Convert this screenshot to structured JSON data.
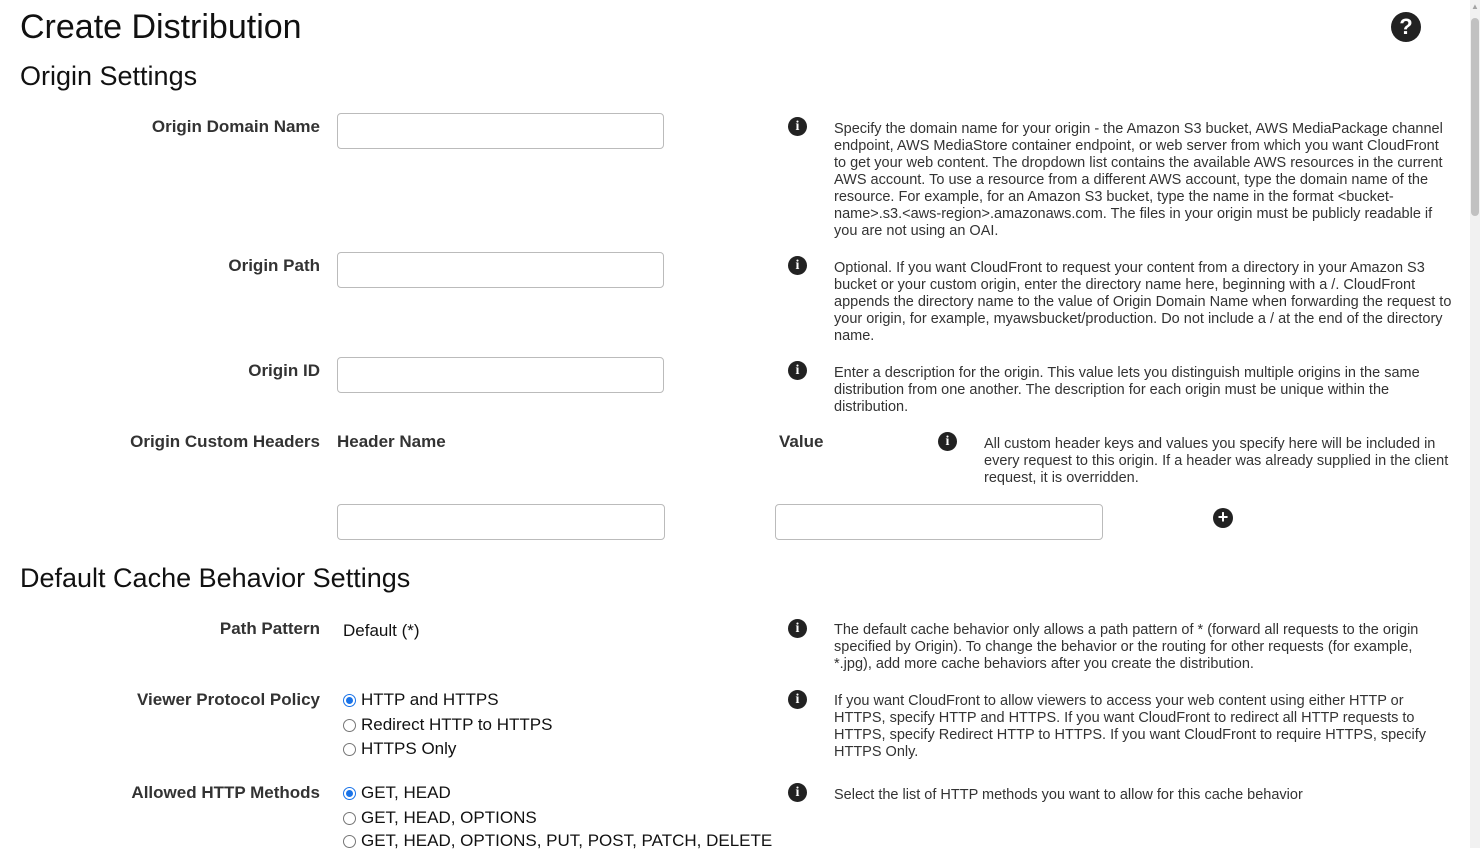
{
  "page": {
    "title": "Create Distribution",
    "help_icon": "question-circle-icon"
  },
  "origin_settings": {
    "heading": "Origin Settings",
    "origin_domain_name": {
      "label": "Origin Domain Name",
      "value": "",
      "help": "Specify the domain name for your origin - the Amazon S3 bucket, AWS MediaPackage channel endpoint, AWS MediaStore container endpoint, or web server from which you want CloudFront to get your web content. The dropdown list contains the available AWS resources in the current AWS account. To use a resource from a different AWS account, type the domain name of the resource. For example, for an Amazon S3 bucket, type the name in the format <bucket-name>.s3.<aws-region>.amazonaws.com. The files in your origin must be publicly readable if you are not using an OAI."
    },
    "origin_path": {
      "label": "Origin Path",
      "value": "",
      "help": "Optional. If you want CloudFront to request your content from a directory in your Amazon S3 bucket or your custom origin, enter the directory name here, beginning with a /. CloudFront appends the directory name to the value of Origin Domain Name when forwarding the request to your origin, for example, myawsbucket/production. Do not include a / at the end of the directory name."
    },
    "origin_id": {
      "label": "Origin ID",
      "value": "",
      "help": "Enter a description for the origin. This value lets you distinguish multiple origins in the same distribution from one another. The description for each origin must be unique within the distribution."
    },
    "custom_headers": {
      "label": "Origin Custom Headers",
      "header_name_col": "Header Name",
      "value_col": "Value",
      "header_name_value": "",
      "header_value_value": "",
      "help": "All custom header keys and values you specify here will be included in every request to this origin. If a header was already supplied in the client request, it is overridden."
    }
  },
  "cache_behavior": {
    "heading": "Default Cache Behavior Settings",
    "path_pattern": {
      "label": "Path Pattern",
      "value": "Default (*)",
      "help": "The default cache behavior only allows a path pattern of * (forward all requests to the origin specified by Origin). To change the behavior or the routing for other requests (for example, *.jpg), add more cache behaviors after you create the distribution."
    },
    "viewer_protocol": {
      "label": "Viewer Protocol Policy",
      "options": [
        "HTTP and HTTPS",
        "Redirect HTTP to HTTPS",
        "HTTPS Only"
      ],
      "selected": "HTTP and HTTPS",
      "help": "If you want CloudFront to allow viewers to access your web content using either HTTP or HTTPS, specify HTTP and HTTPS. If you want CloudFront to redirect all HTTP requests to HTTPS, specify Redirect HTTP to HTTPS. If you want CloudFront to require HTTPS, specify HTTPS Only."
    },
    "allowed_methods": {
      "label": "Allowed HTTP Methods",
      "options": [
        "GET, HEAD",
        "GET, HEAD, OPTIONS",
        "GET, HEAD, OPTIONS, PUT, POST, PATCH, DELETE"
      ],
      "selected": "GET, HEAD",
      "help": "Select the list of HTTP methods you want to allow for this cache behavior"
    }
  },
  "icons": {
    "info": "info-icon",
    "add": "plus-circle-icon"
  }
}
